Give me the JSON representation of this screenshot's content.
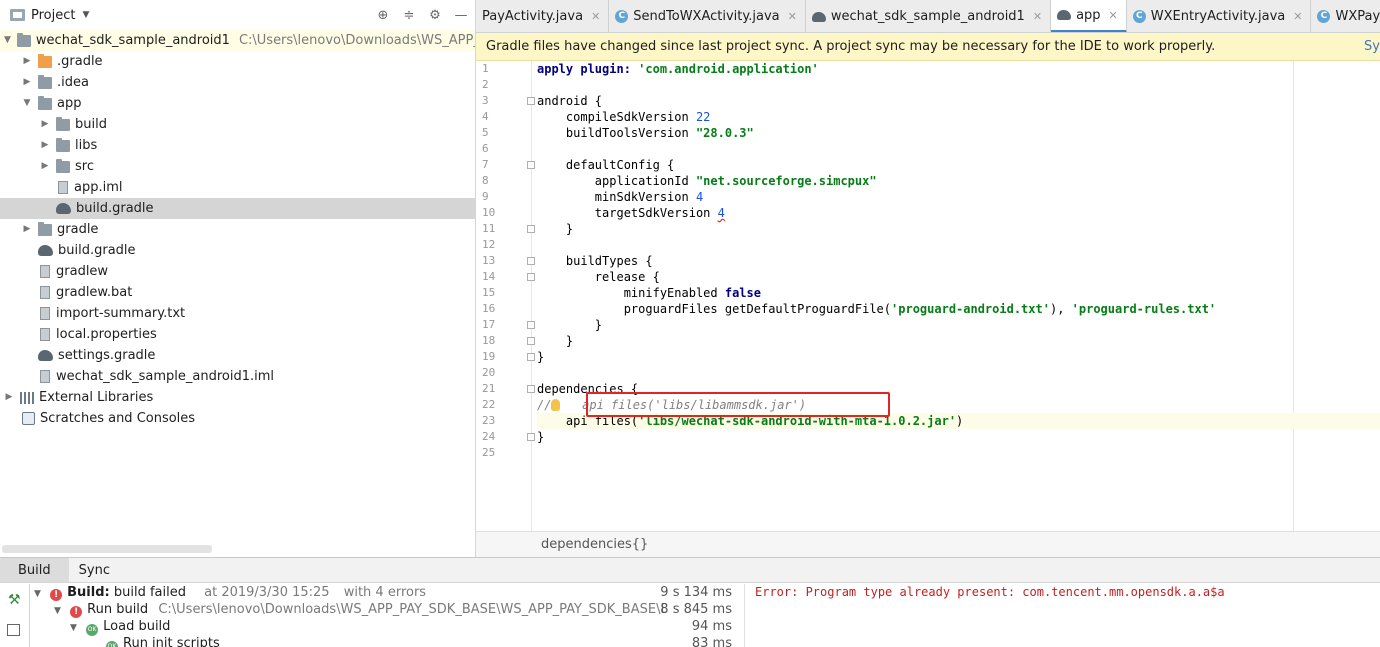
{
  "project_panel": {
    "title": "Project",
    "root": {
      "name": "wechat_sdk_sample_android1",
      "path": "C:\\Users\\lenovo\\Downloads\\WS_APP_PAY_S"
    },
    "items": [
      {
        "label": ".gradle"
      },
      {
        "label": ".idea"
      },
      {
        "label": "app"
      },
      {
        "label": "build"
      },
      {
        "label": "libs"
      },
      {
        "label": "src"
      },
      {
        "label": "app.iml"
      },
      {
        "label": "build.gradle"
      },
      {
        "label": "gradle"
      },
      {
        "label": "build.gradle"
      },
      {
        "label": "gradlew"
      },
      {
        "label": "gradlew.bat"
      },
      {
        "label": "import-summary.txt"
      },
      {
        "label": "local.properties"
      },
      {
        "label": "settings.gradle"
      },
      {
        "label": "wechat_sdk_sample_android1.iml"
      },
      {
        "label": "External Libraries"
      },
      {
        "label": "Scratches and Consoles"
      }
    ]
  },
  "tabs": [
    {
      "label": "PayActivity.java"
    },
    {
      "label": "SendToWXActivity.java"
    },
    {
      "label": "wechat_sdk_sample_android1"
    },
    {
      "label": "app"
    },
    {
      "label": "WXEntryActivity.java"
    },
    {
      "label": "WXPayEntryActivity.java"
    }
  ],
  "sync_banner": {
    "message": "Gradle files have changed since last project sync. A project sync may be necessary for the IDE to work properly.",
    "action": "Sy"
  },
  "editor": {
    "line_numbers": [
      "1",
      "2",
      "3",
      "4",
      "5",
      "6",
      "7",
      "8",
      "9",
      "10",
      "11",
      "12",
      "13",
      "14",
      "15",
      "16",
      "17",
      "18",
      "19",
      "20",
      "21",
      "22",
      "23",
      "24",
      "25"
    ],
    "code": {
      "l1_kw": "apply plugin: ",
      "l1_str": "'com.android.application'",
      "l3": "android {",
      "l4_a": "    compileSdkVersion ",
      "l4_b": "22",
      "l5_a": "    buildToolsVersion ",
      "l5_b": "\"28.0.3\"",
      "l7": "    defaultConfig {",
      "l8_a": "        applicationId ",
      "l8_b": "\"net.sourceforge.simcpux\"",
      "l9_a": "        minSdkVersion ",
      "l9_b": "4",
      "l10_a": "        targetSdkVersion ",
      "l10_b": "4",
      "l11": "    }",
      "l13": "    buildTypes {",
      "l14": "        release {",
      "l15_a": "            minifyEnabled ",
      "l15_b": "false",
      "l16_a": "            proguardFiles getDefaultProguardFile(",
      "l16_b": "'proguard-android.txt'",
      "l16_c": "), ",
      "l16_d": "'proguard-rules.txt'",
      "l17": "        }",
      "l18": "    }",
      "l19": "}",
      "l21": "dependencies {",
      "l22_a": "//",
      "l22_b": "   api files('libs/libammsdk.jar')",
      "l23_a": "    api files(",
      "l23_b": "'libs/wechat-sdk-android-with-mta-1.0.2.jar'",
      "l23_c": ")",
      "l24": "}"
    },
    "breadcrumb": "dependencies{}"
  },
  "build_window": {
    "tabs": [
      "Build",
      "Sync"
    ],
    "rows": [
      {
        "bold": "Build:",
        "text": " build failed",
        "meta": "at 2019/3/30 15:25",
        "meta2": "with 4 errors",
        "duration": "9 s 134 ms"
      },
      {
        "text": "Run build",
        "meta": "C:\\Users\\lenovo\\Downloads\\WS_APP_PAY_SDK_BASE\\WS_APP_PAY_SDK_BASE\\Demo\\An",
        "duration": "8 s 845 ms"
      },
      {
        "text": "Load build",
        "duration": "94 ms"
      },
      {
        "text": "Run init scripts",
        "duration": "83 ms"
      }
    ],
    "ok_badge": "OK",
    "error_output": "Error: Program type already present: com.tencent.mm.opensdk.a.a$a"
  },
  "icons": {
    "project_header": [
      "crosshair-icon",
      "collapse-icon",
      "gear-icon",
      "minimize-icon"
    ]
  }
}
